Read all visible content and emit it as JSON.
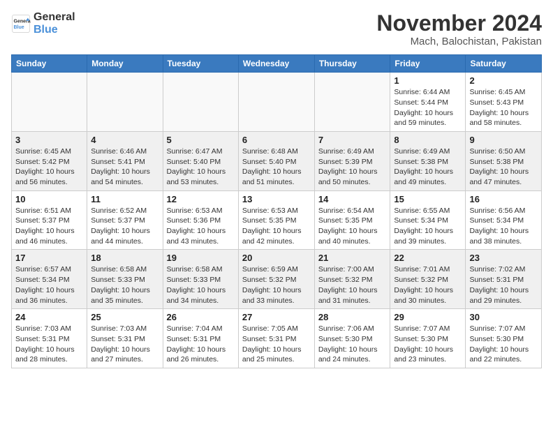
{
  "logo": {
    "general": "General",
    "blue": "Blue"
  },
  "title": "November 2024",
  "location": "Mach, Balochistan, Pakistan",
  "days_of_week": [
    "Sunday",
    "Monday",
    "Tuesday",
    "Wednesday",
    "Thursday",
    "Friday",
    "Saturday"
  ],
  "weeks": [
    [
      {
        "day": "",
        "info": ""
      },
      {
        "day": "",
        "info": ""
      },
      {
        "day": "",
        "info": ""
      },
      {
        "day": "",
        "info": ""
      },
      {
        "day": "",
        "info": ""
      },
      {
        "day": "1",
        "info": "Sunrise: 6:44 AM\nSunset: 5:44 PM\nDaylight: 10 hours and 59 minutes."
      },
      {
        "day": "2",
        "info": "Sunrise: 6:45 AM\nSunset: 5:43 PM\nDaylight: 10 hours and 58 minutes."
      }
    ],
    [
      {
        "day": "3",
        "info": "Sunrise: 6:45 AM\nSunset: 5:42 PM\nDaylight: 10 hours and 56 minutes."
      },
      {
        "day": "4",
        "info": "Sunrise: 6:46 AM\nSunset: 5:41 PM\nDaylight: 10 hours and 54 minutes."
      },
      {
        "day": "5",
        "info": "Sunrise: 6:47 AM\nSunset: 5:40 PM\nDaylight: 10 hours and 53 minutes."
      },
      {
        "day": "6",
        "info": "Sunrise: 6:48 AM\nSunset: 5:40 PM\nDaylight: 10 hours and 51 minutes."
      },
      {
        "day": "7",
        "info": "Sunrise: 6:49 AM\nSunset: 5:39 PM\nDaylight: 10 hours and 50 minutes."
      },
      {
        "day": "8",
        "info": "Sunrise: 6:49 AM\nSunset: 5:38 PM\nDaylight: 10 hours and 49 minutes."
      },
      {
        "day": "9",
        "info": "Sunrise: 6:50 AM\nSunset: 5:38 PM\nDaylight: 10 hours and 47 minutes."
      }
    ],
    [
      {
        "day": "10",
        "info": "Sunrise: 6:51 AM\nSunset: 5:37 PM\nDaylight: 10 hours and 46 minutes."
      },
      {
        "day": "11",
        "info": "Sunrise: 6:52 AM\nSunset: 5:37 PM\nDaylight: 10 hours and 44 minutes."
      },
      {
        "day": "12",
        "info": "Sunrise: 6:53 AM\nSunset: 5:36 PM\nDaylight: 10 hours and 43 minutes."
      },
      {
        "day": "13",
        "info": "Sunrise: 6:53 AM\nSunset: 5:35 PM\nDaylight: 10 hours and 42 minutes."
      },
      {
        "day": "14",
        "info": "Sunrise: 6:54 AM\nSunset: 5:35 PM\nDaylight: 10 hours and 40 minutes."
      },
      {
        "day": "15",
        "info": "Sunrise: 6:55 AM\nSunset: 5:34 PM\nDaylight: 10 hours and 39 minutes."
      },
      {
        "day": "16",
        "info": "Sunrise: 6:56 AM\nSunset: 5:34 PM\nDaylight: 10 hours and 38 minutes."
      }
    ],
    [
      {
        "day": "17",
        "info": "Sunrise: 6:57 AM\nSunset: 5:34 PM\nDaylight: 10 hours and 36 minutes."
      },
      {
        "day": "18",
        "info": "Sunrise: 6:58 AM\nSunset: 5:33 PM\nDaylight: 10 hours and 35 minutes."
      },
      {
        "day": "19",
        "info": "Sunrise: 6:58 AM\nSunset: 5:33 PM\nDaylight: 10 hours and 34 minutes."
      },
      {
        "day": "20",
        "info": "Sunrise: 6:59 AM\nSunset: 5:32 PM\nDaylight: 10 hours and 33 minutes."
      },
      {
        "day": "21",
        "info": "Sunrise: 7:00 AM\nSunset: 5:32 PM\nDaylight: 10 hours and 31 minutes."
      },
      {
        "day": "22",
        "info": "Sunrise: 7:01 AM\nSunset: 5:32 PM\nDaylight: 10 hours and 30 minutes."
      },
      {
        "day": "23",
        "info": "Sunrise: 7:02 AM\nSunset: 5:31 PM\nDaylight: 10 hours and 29 minutes."
      }
    ],
    [
      {
        "day": "24",
        "info": "Sunrise: 7:03 AM\nSunset: 5:31 PM\nDaylight: 10 hours and 28 minutes."
      },
      {
        "day": "25",
        "info": "Sunrise: 7:03 AM\nSunset: 5:31 PM\nDaylight: 10 hours and 27 minutes."
      },
      {
        "day": "26",
        "info": "Sunrise: 7:04 AM\nSunset: 5:31 PM\nDaylight: 10 hours and 26 minutes."
      },
      {
        "day": "27",
        "info": "Sunrise: 7:05 AM\nSunset: 5:31 PM\nDaylight: 10 hours and 25 minutes."
      },
      {
        "day": "28",
        "info": "Sunrise: 7:06 AM\nSunset: 5:30 PM\nDaylight: 10 hours and 24 minutes."
      },
      {
        "day": "29",
        "info": "Sunrise: 7:07 AM\nSunset: 5:30 PM\nDaylight: 10 hours and 23 minutes."
      },
      {
        "day": "30",
        "info": "Sunrise: 7:07 AM\nSunset: 5:30 PM\nDaylight: 10 hours and 22 minutes."
      }
    ]
  ]
}
